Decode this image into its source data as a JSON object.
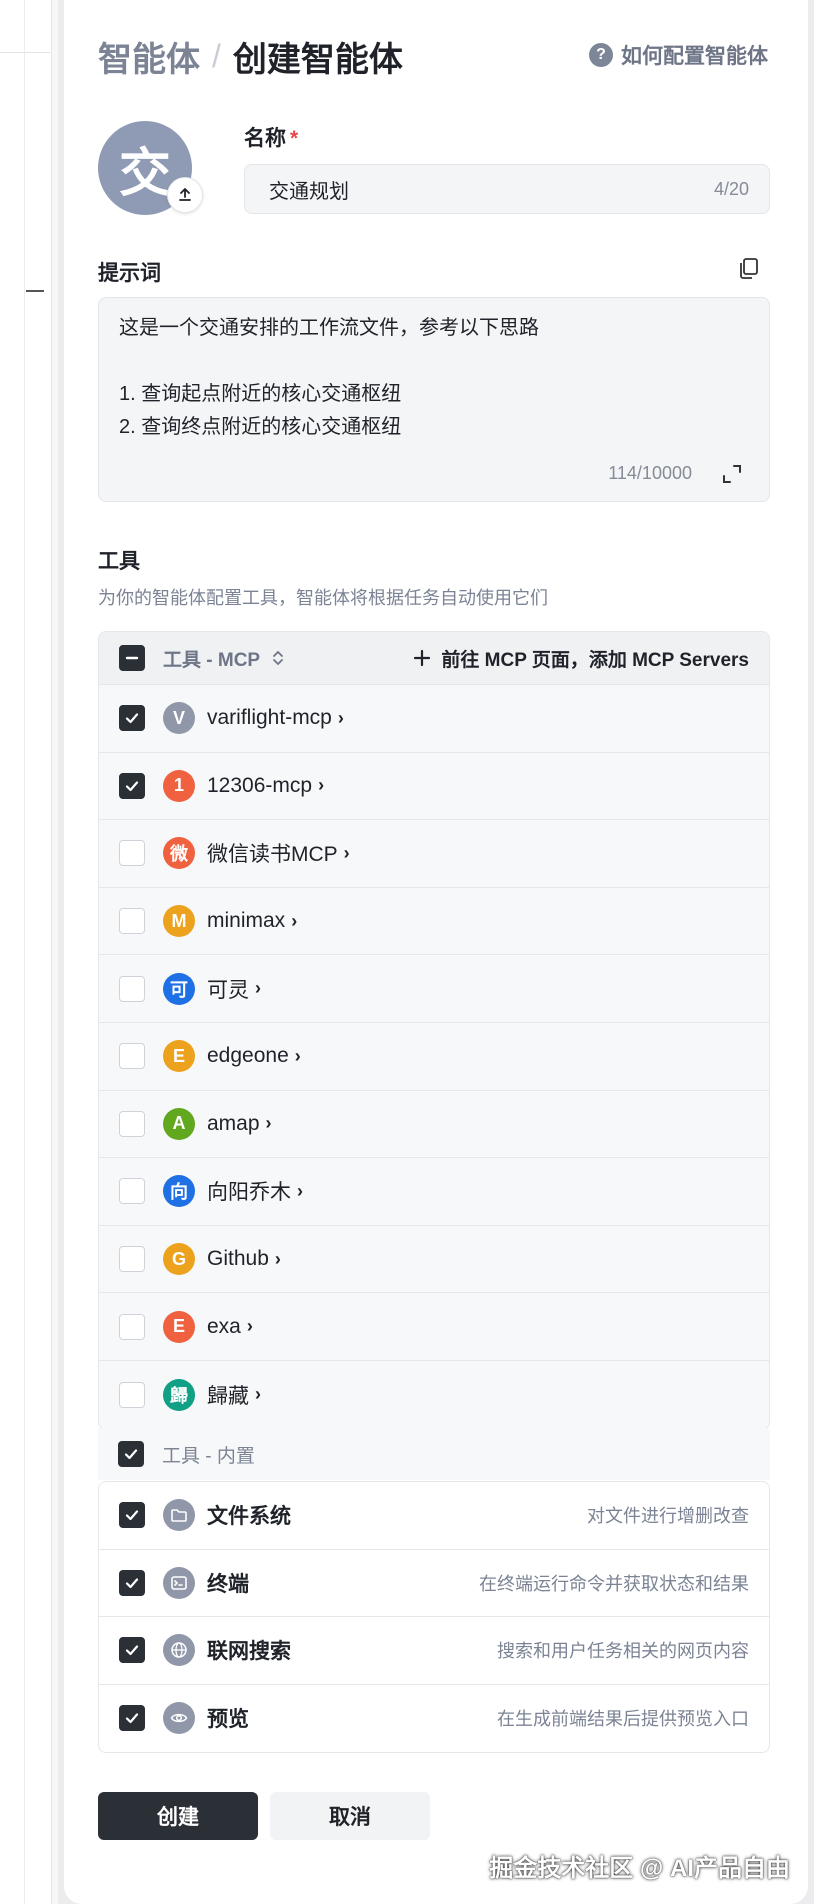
{
  "header": {
    "breadcrumb_parent": "智能体",
    "breadcrumb_separator": "/",
    "page_title": "创建智能体",
    "help_icon_glyph": "?",
    "help_link": "如何配置智能体"
  },
  "avatar": {
    "letter": "交",
    "color": "#8f9ab4",
    "upload_icon": "upload-icon"
  },
  "name_field": {
    "label": "名称",
    "required_mark": "*",
    "value": "交通规划",
    "count": "4/20"
  },
  "prompt_field": {
    "label": "提示词",
    "lines": [
      "这是一个交通安排的工作流文件，参考以下思路",
      "",
      "1. 查询起点附近的核心交通枢纽",
      "2. 查询终点附近的核心交通枢纽"
    ],
    "count": "114/10000"
  },
  "tools": {
    "title": "工具",
    "description": "为你的智能体配置工具，智能体将根据任务自动使用它们",
    "mcp_group_label": "工具 - MCP",
    "add_mcp_label": "前往 MCP 页面，添加 MCP Servers",
    "mcp_items": [
      {
        "letter": "V",
        "name": "variflight-mcp",
        "checked": true,
        "color": "#8f97a8"
      },
      {
        "letter": "1",
        "name": "12306-mcp",
        "checked": true,
        "color": "#f0613f"
      },
      {
        "letter": "微",
        "name": "微信读书MCP",
        "checked": false,
        "color": "#f0613f"
      },
      {
        "letter": "M",
        "name": "minimax",
        "checked": false,
        "color": "#eda21e"
      },
      {
        "letter": "可",
        "name": "可灵",
        "checked": false,
        "color": "#1f6fe5"
      },
      {
        "letter": "E",
        "name": "edgeone",
        "checked": false,
        "color": "#eda21e"
      },
      {
        "letter": "A",
        "name": "amap",
        "checked": false,
        "color": "#62a81e"
      },
      {
        "letter": "向",
        "name": "向阳乔木",
        "checked": false,
        "color": "#1f6fe5"
      },
      {
        "letter": "G",
        "name": "Github",
        "checked": false,
        "color": "#eda21e"
      },
      {
        "letter": "E",
        "name": "exa",
        "checked": false,
        "color": "#f0613f"
      },
      {
        "letter": "歸",
        "name": "歸藏",
        "checked": false,
        "color": "#10a085"
      }
    ],
    "builtin_group_label": "工具 - 内置",
    "builtin_items": [
      {
        "icon": "folder-icon",
        "name": "文件系统",
        "desc": "对文件进行增删改查",
        "checked": true
      },
      {
        "icon": "terminal-icon",
        "name": "终端",
        "desc": "在终端运行命令并获取状态和结果",
        "checked": true
      },
      {
        "icon": "globe-icon",
        "name": "联网搜索",
        "desc": "搜索和用户任务相关的网页内容",
        "checked": true
      },
      {
        "icon": "eye-icon",
        "name": "预览",
        "desc": "在生成前端结果后提供预览入口",
        "checked": true
      }
    ]
  },
  "actions": {
    "create": "创建",
    "cancel": "取消"
  },
  "watermark": "掘金技术社区 @ AI产品自由"
}
